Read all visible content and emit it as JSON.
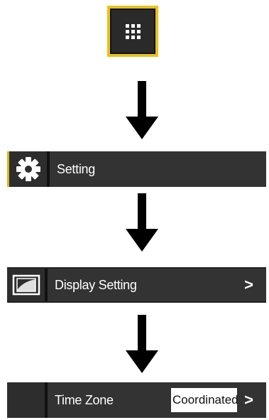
{
  "apps_button": {
    "icon": "apps-grid-icon",
    "border_color": "#e8c21a"
  },
  "setting_row": {
    "label": "Setting",
    "icon": "gear-icon"
  },
  "display_row": {
    "label": "Display Setting",
    "icon": "display-icon",
    "chevron": ">"
  },
  "timezone_row": {
    "label": "Time Zone",
    "value": "Coordinated",
    "chevron": ">"
  },
  "colors": {
    "bar": "#333333",
    "accent": "#e8c21a",
    "text": "#ffffff"
  }
}
